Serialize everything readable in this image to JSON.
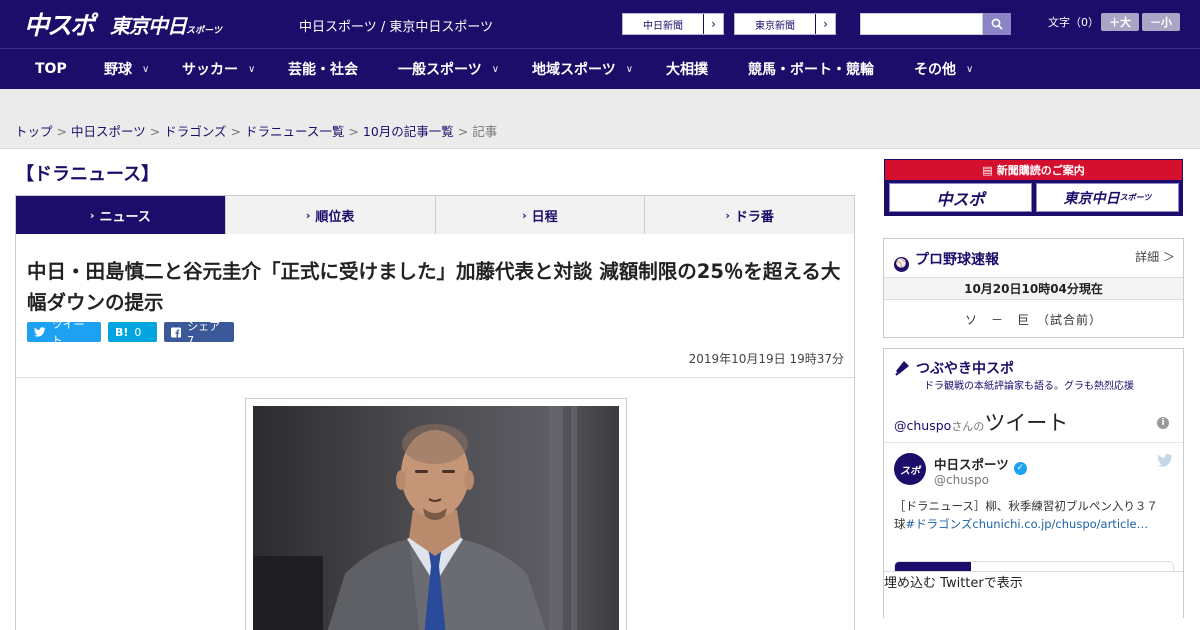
{
  "header": {
    "logo_main": "中スポ",
    "logo_sub": "東京中日",
    "logo_sub_small": "スポーツ",
    "site_title": "中日スポーツ / 東京中日スポーツ",
    "paper_links": [
      "中日新聞",
      "東京新聞"
    ],
    "font_size_label": "文字（0）",
    "font_larger": "＋大",
    "font_smaller": "－小"
  },
  "nav": {
    "items": [
      {
        "label": "TOP",
        "has_menu": false
      },
      {
        "label": "野球",
        "has_menu": true
      },
      {
        "label": "サッカー",
        "has_menu": true
      },
      {
        "label": "芸能・社会",
        "has_menu": false
      },
      {
        "label": "一般スポーツ",
        "has_menu": true
      },
      {
        "label": "地域スポーツ",
        "has_menu": true
      },
      {
        "label": "大相撲",
        "has_menu": false
      },
      {
        "label": "競馬・ボート・競輪",
        "has_menu": false
      },
      {
        "label": "その他",
        "has_menu": true
      }
    ]
  },
  "breadcrumb": [
    "トップ",
    "中日スポーツ",
    "ドラゴンズ",
    "ドラニュース一覧",
    "10月の記事一覧",
    "記事"
  ],
  "section_title": "【ドラニュース】",
  "tabs": [
    "ニュース",
    "順位表",
    "日程",
    "ドラ番"
  ],
  "article": {
    "headline": "中日・田島慎二と谷元圭介「正式に受けました」加藤代表と対談 減額制限の25％を超える大幅ダウンの提示",
    "share": {
      "tweet": "ツイート",
      "hatena_mark": "B!",
      "hatena_count": "0",
      "facebook": "シェア 7"
    },
    "published": "2019年10月19日 19時37分"
  },
  "sidebar": {
    "subscribe_banner": {
      "title": "新聞購読のご案内",
      "logo_left": "中スポ",
      "logo_right": "東京中日",
      "logo_right_small": "スポーツ"
    },
    "baseball": {
      "title": "プロ野球速報",
      "more": "詳細 ＞",
      "time": "10月20日10時04分現在",
      "score": "ソ　－　巨　（試合前）"
    },
    "twitter": {
      "title": "つぶやき中スポ",
      "subtitle": "ドラ観戦の本紙評論家も語る。グラも熱烈応援",
      "handle": "@chuspo",
      "san": "さんの",
      "tweets_word": "ツイート",
      "account_name": "中日スポーツ",
      "account_handle": "@chuspo",
      "tweet_text_prefix": "［ドラニュース］柳、秋季練習初ブルペン入り３７球",
      "tweet_text_link": "#ドラゴンズchunichi.co.jp/chuspo/article…",
      "embed": "埋め込む",
      "view_on_twitter": "Twitterで表示"
    }
  },
  "colors": {
    "brand_navy": "#1c0d6b",
    "subscribe_red": "#d5102f",
    "twitter_blue": "#1da1f2",
    "facebook_blue": "#3b5998"
  }
}
